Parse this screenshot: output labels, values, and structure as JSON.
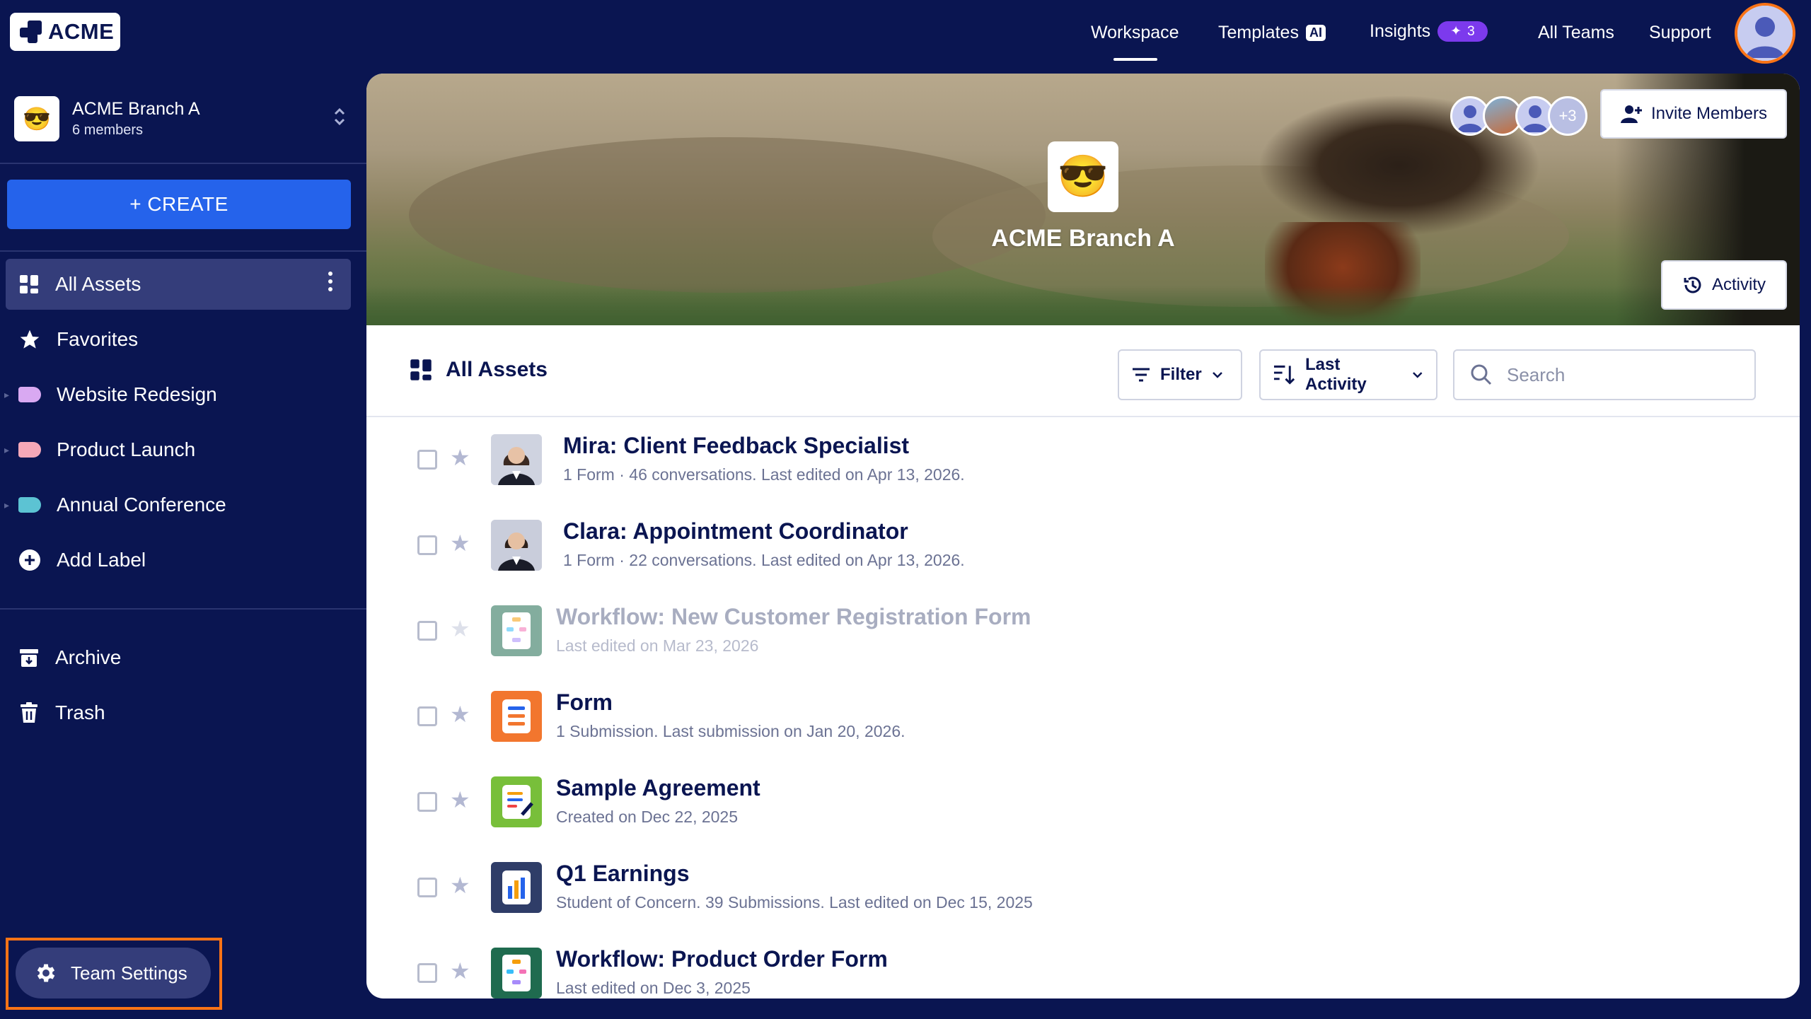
{
  "header": {
    "logo_text": "ACME",
    "nav": {
      "workspace": "Workspace",
      "templates": "Templates",
      "templates_badge": "AI",
      "insights": "Insights",
      "insights_count": "3",
      "all_teams": "All Teams",
      "support": "Support"
    }
  },
  "sidebar": {
    "team_name": "ACME Branch A",
    "team_members": "6 members",
    "team_emoji": "😎",
    "create_label": "+ CREATE",
    "items": {
      "all_assets": "All Assets",
      "favorites": "Favorites",
      "website_redesign": "Website Redesign",
      "product_launch": "Product Launch",
      "annual_conference": "Annual Conference",
      "add_label": "Add Label",
      "archive": "Archive",
      "trash": "Trash"
    },
    "label_colors": {
      "website_redesign": "#d9a9f2",
      "product_launch": "#f5a8b8",
      "annual_conference": "#5cc3d3"
    },
    "team_settings": "Team Settings"
  },
  "banner": {
    "title": "ACME Branch A",
    "emoji": "😎",
    "members_more": "+3",
    "invite_label": "Invite Members",
    "activity_label": "Activity"
  },
  "toolbar": {
    "title": "All Assets",
    "filter_label": "Filter",
    "sort_label": "Last Activity",
    "search_placeholder": "Search"
  },
  "assets": [
    {
      "title": "Mira: Client Feedback Specialist",
      "subtitle": "1 Form · 46 conversations. Last edited on Apr 13, 2026.",
      "icon": "agent-avatar"
    },
    {
      "title": "Clara: Appointment Coordinator",
      "subtitle": "1 Form · 22 conversations. Last edited on Apr 13, 2026.",
      "icon": "agent-avatar"
    },
    {
      "title": "Workflow: New Customer Registration Form",
      "subtitle": "Last edited on Mar 23, 2026",
      "icon": "workflow-icon"
    },
    {
      "title": "Form",
      "subtitle": "1 Submission.  Last submission on Jan 20, 2026.",
      "icon": "form-icon"
    },
    {
      "title": "Sample Agreement",
      "subtitle": "Created on Dec 22, 2025",
      "icon": "sign-document-icon"
    },
    {
      "title": "Q1 Earnings",
      "subtitle": "Student of Concern. 39 Submissions. Last edited on Dec 15, 2025",
      "icon": "table-chart-icon"
    },
    {
      "title": "Workflow: Product Order Form",
      "subtitle": "Last edited on Dec 3, 2025",
      "icon": "workflow-icon"
    }
  ],
  "colors": {
    "navy": "#0a1551",
    "accent_blue": "#2563eb",
    "highlight_orange": "#f97316",
    "insights_purple": "#7c3aed"
  }
}
